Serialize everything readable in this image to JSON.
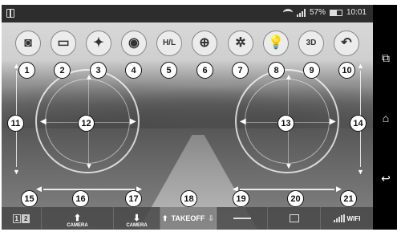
{
  "status_bar": {
    "battery_percent": "57%",
    "time": "10:01"
  },
  "toolbar": {
    "buttons": [
      {
        "name": "camera-icon",
        "glyph": "◙"
      },
      {
        "name": "video-icon",
        "glyph": "▭"
      },
      {
        "name": "gyro-calibrate-icon",
        "glyph": "✦"
      },
      {
        "name": "view-eye-icon",
        "glyph": "◉"
      },
      {
        "name": "high-low-speed",
        "glyph": "H/L"
      },
      {
        "name": "headless-icon",
        "glyph": "⊕"
      },
      {
        "name": "flip-icon",
        "glyph": "✲"
      },
      {
        "name": "light-bulb-icon",
        "glyph": "💡"
      },
      {
        "name": "3d-view",
        "glyph": "3D"
      },
      {
        "name": "back-arrow-icon",
        "glyph": "↶"
      }
    ]
  },
  "callouts": [
    "1",
    "2",
    "3",
    "4",
    "5",
    "6",
    "7",
    "8",
    "9",
    "10",
    "11",
    "12",
    "13",
    "14",
    "15",
    "16",
    "17",
    "18",
    "19",
    "20",
    "21"
  ],
  "bottom_bar": {
    "camera_left_label": "CAMERA",
    "camera_right_label": "CAMERA",
    "takeoff_label": "TAKEOFF",
    "wifi_label": "WIFI",
    "mode_labels": [
      "1",
      "2"
    ]
  },
  "colors": {
    "status_bar": "#2d2d2d",
    "nav_bar": "#000000",
    "bottom_bar": "#464646"
  }
}
